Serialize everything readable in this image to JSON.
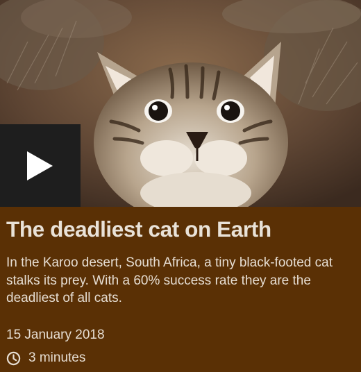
{
  "video": {
    "thumbnail_icon": "kitten-thumbnail",
    "play_icon": "play-icon"
  },
  "article": {
    "title": "The deadliest cat on Earth",
    "description": "In the Karoo desert, South Africa, a tiny black-footed cat stalks its prey. With a 60% success rate they are the deadliest of all cats.",
    "date": "15 January 2018",
    "duration": "3 minutes",
    "duration_icon": "clock-icon"
  },
  "colors": {
    "card_background": "#5a3005",
    "play_background": "#1e1e1e",
    "text": "#e6ddd2"
  }
}
